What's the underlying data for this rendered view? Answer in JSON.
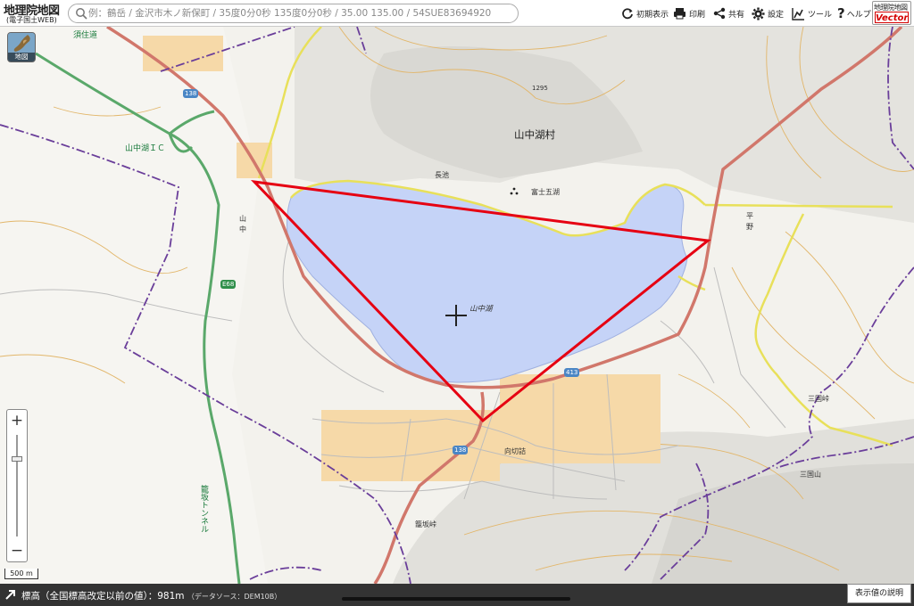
{
  "app": {
    "title": "地理院地図",
    "subtitle": "(電子国土WEB)",
    "vector_line1": "地理院地図",
    "vector_line2": "Vector"
  },
  "search": {
    "placeholder": "例：鶴岳 / 金沢市木ノ新保町 / 35度0分0秒 135度0分0秒 / 35.00 135.00 / 54SUE83694920"
  },
  "toolbar": {
    "initial_view": "初期表示",
    "print": "印刷",
    "share": "共有",
    "settings": "設定",
    "tools": "ツール",
    "help": "ヘルプ"
  },
  "basemap": {
    "label": "地図"
  },
  "zoom": {
    "in": "+",
    "out": "−"
  },
  "scale": {
    "label": "500 m"
  },
  "map_labels": {
    "yamanakako_village": "山中湖村",
    "nagaike": "長池",
    "fujigoko": "富士五湖",
    "hirano_1": "平",
    "hirano_2": "野",
    "yamanaka_1": "山",
    "yamanaka_2": "中",
    "lake": "山中湖",
    "mukaikiritsume": "向切詰",
    "kagosaka_pass": "籠坂峠",
    "mikuni_pass": "三国峠",
    "mikuniyama": "三国山",
    "yamanakako_ic": "山中湖ＩＣ",
    "kagosaka_tunnel": "籠坂トンネル",
    "top_label": "須住道",
    "elev_1295": "1295"
  },
  "road_shields": {
    "r138_a": "138",
    "r138_b": "138",
    "r413": "413",
    "e68": "E68"
  },
  "status": {
    "elevation_label": "標高（全国標高改定以前の値）：",
    "elevation_value": "981m",
    "data_source": "（データソース：DEM10B）",
    "explain_button": "表示値の説明"
  },
  "colors": {
    "lake_fill": "#c5d3f7",
    "triangle_stroke": "#e60012",
    "national_road": "#d1776b",
    "prefecture_road": "#e8e05a",
    "expressway": "#5aa86a",
    "boundary": "#6a3e9a",
    "contour": "#e2b66a"
  }
}
